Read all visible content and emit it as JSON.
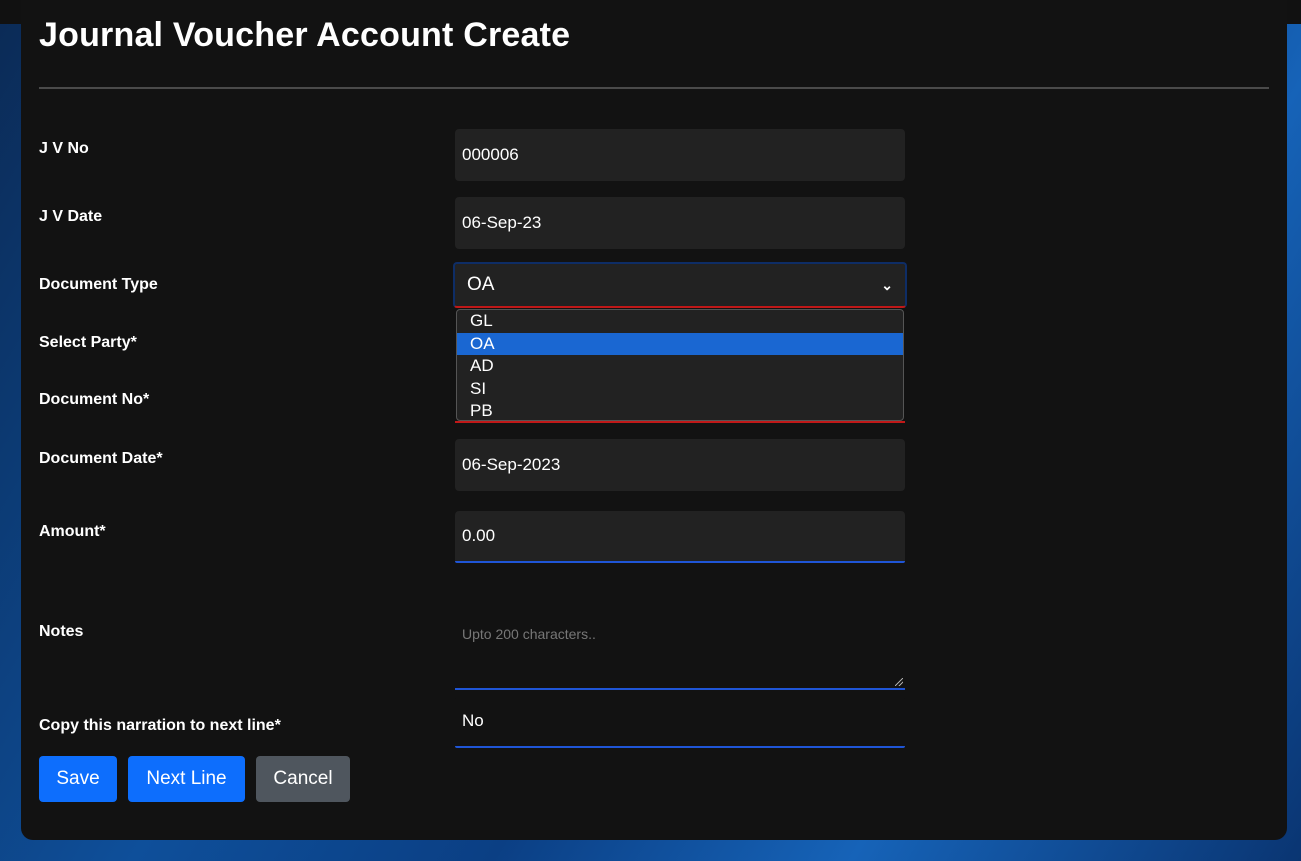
{
  "page": {
    "title": "Journal Voucher Account Create"
  },
  "form": {
    "jv_no": {
      "label": "J V No",
      "value": "000006"
    },
    "jv_date": {
      "label": "J V Date",
      "value": "06-Sep-23"
    },
    "document_type": {
      "label": "Document Type",
      "value": "OA",
      "options": [
        "GL",
        "OA",
        "AD",
        "SI",
        "PB"
      ]
    },
    "select_party": {
      "label": "Select Party*"
    },
    "document_no": {
      "label": "Document No*"
    },
    "document_date": {
      "label": "Document Date*",
      "value": "06-Sep-2023"
    },
    "amount": {
      "label": "Amount*",
      "value": "0.00"
    },
    "notes": {
      "label": "Notes",
      "placeholder": "Upto 200 characters.."
    },
    "copy_narration": {
      "label": "Copy this narration to next line*",
      "value": "No"
    }
  },
  "buttons": {
    "save": "Save",
    "next_line": "Next Line",
    "cancel": "Cancel"
  },
  "colors": {
    "primary": "#0d6efd",
    "secondary": "#4f565e",
    "selected_option": "#1a67d2",
    "error": "#c01818"
  }
}
